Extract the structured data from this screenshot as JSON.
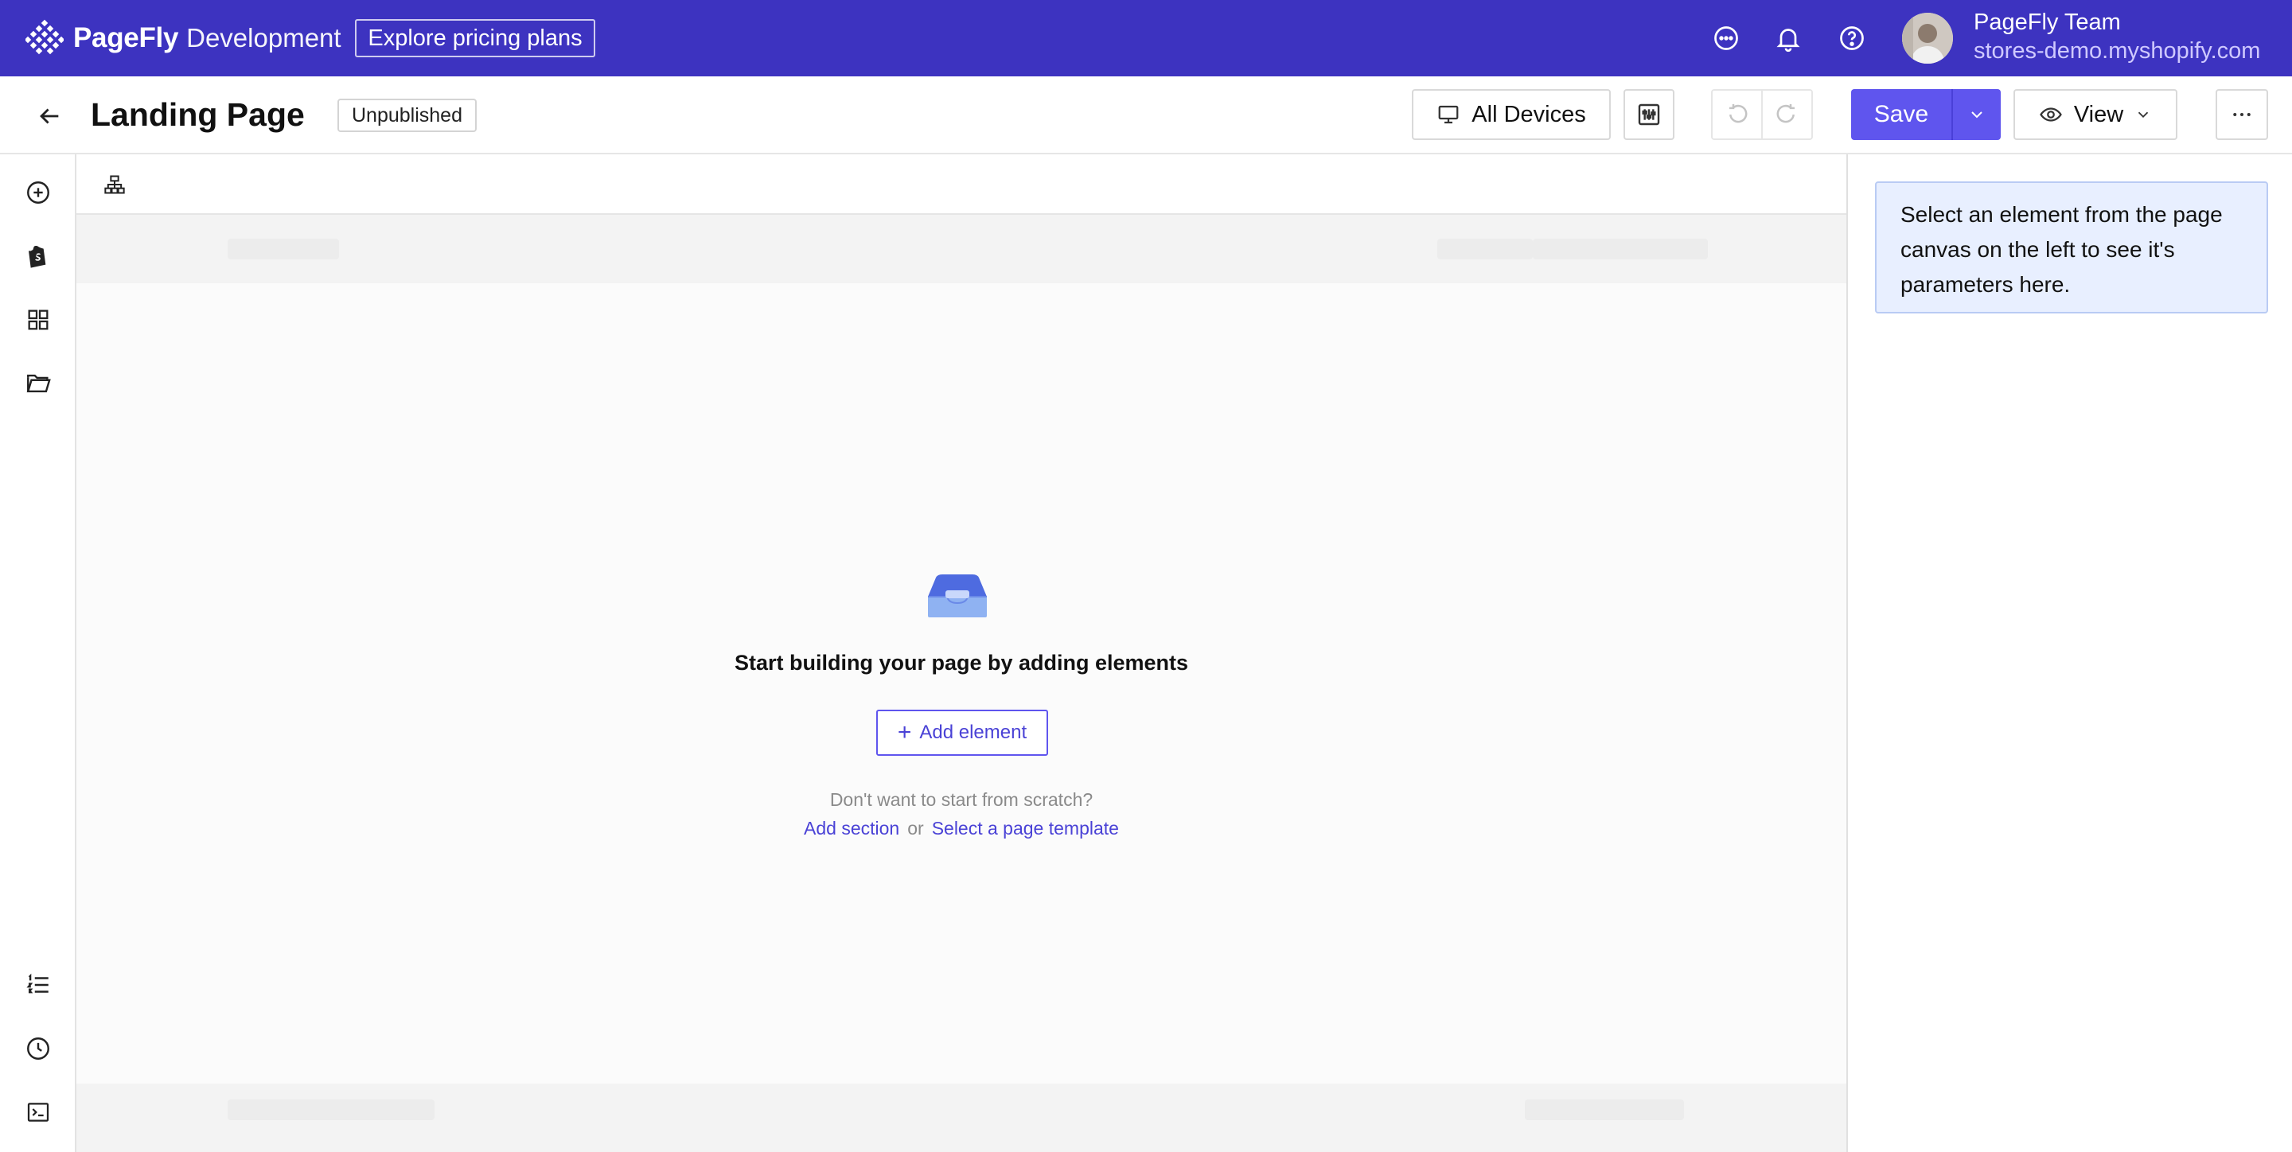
{
  "topbar": {
    "brand_name": "PageFly",
    "brand_env": "Development",
    "pricing_button": "Explore pricing plans",
    "user_name": "PageFly Team",
    "user_store": "stores-demo.myshopify.com",
    "icons": [
      "chat-icon",
      "bell-icon",
      "help-icon"
    ],
    "colors": {
      "background": "#3d33c0",
      "text": "#ffffff"
    }
  },
  "header": {
    "title": "Landing Page",
    "status": "Unpublished",
    "device_label": "All Devices",
    "save_label": "Save",
    "view_label": "View",
    "colors": {
      "accent": "#5f55ee"
    }
  },
  "sidebar": {
    "icons": [
      "add-icon",
      "shopify-icon",
      "grid-icon",
      "folder-icon",
      "list-icon",
      "history-icon",
      "terminal-icon"
    ]
  },
  "canvas": {
    "empty_title": "Start building your page by adding elements",
    "add_element_label": "Add element",
    "scratch_text": "Don't want to start from scratch?",
    "add_section_label": "Add section",
    "or_label": "or",
    "template_label": "Select a page template"
  },
  "right_panel": {
    "hint": "Select an element from the page canvas on the left to see it's parameters here."
  }
}
